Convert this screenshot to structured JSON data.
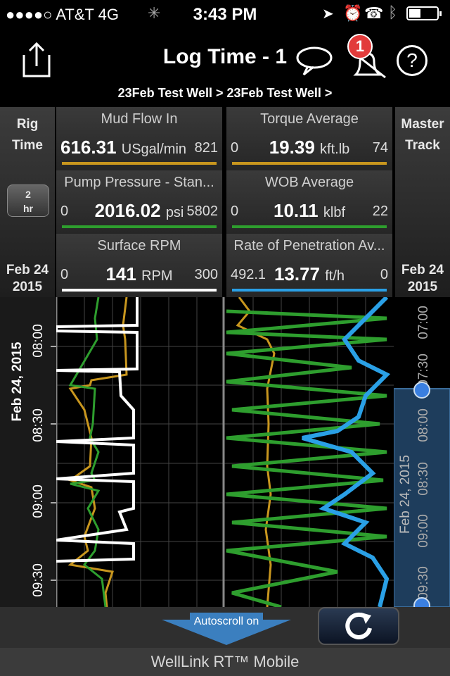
{
  "status_bar": {
    "carrier": "●●●●○ AT&T  4G",
    "time": "3:43 PM"
  },
  "header": {
    "title": "Log Time - 1",
    "notification_count": "1",
    "breadcrumb": "23Feb Test Well > 23Feb Test Well >",
    "icons": [
      "share-icon",
      "comment-icon",
      "bell-icon",
      "help-icon"
    ]
  },
  "left_panel": {
    "label_line1": "Rig",
    "label_line2": "Time",
    "range_value": "2",
    "range_unit": "hr",
    "date_line1": "Feb 24",
    "date_line2": "2015"
  },
  "right_panel": {
    "label_line1": "Master",
    "label_line2": "Track",
    "date_line1": "Feb 24",
    "date_line2": "2015"
  },
  "gauges": [
    {
      "name": "Mud Flow In",
      "value": "616.31",
      "unit": "USgal/min",
      "min": "",
      "max": "821",
      "color": "#c8961e"
    },
    {
      "name": "Torque Average",
      "value": "19.39",
      "unit": "kft.lb",
      "min": "0",
      "max": "74",
      "color": "#c8961e"
    },
    {
      "name": "Pump Pressure - Stan...",
      "value": "2016.02",
      "unit": "psi",
      "min": "0",
      "max": "5802",
      "color": "#2e9e2e"
    },
    {
      "name": "WOB Average",
      "value": "10.11",
      "unit": "klbf",
      "min": "0",
      "max": "22",
      "color": "#2e9e2e"
    },
    {
      "name": "Surface RPM",
      "value": "141",
      "unit": "RPM",
      "min": "0",
      "max": "300",
      "color": "#ffffff"
    },
    {
      "name": "Rate of Penetration Av...",
      "value": "13.77",
      "unit": "ft/h",
      "min": "492.1",
      "max": "0",
      "color": "#2aa0e6"
    }
  ],
  "time_axis": {
    "date_label": "Feb 24, 2015",
    "ticks": [
      "08:00",
      "08:30",
      "09:00",
      "09:30"
    ]
  },
  "master_track": {
    "date_label": "Feb 24, 2015",
    "ticks": [
      "07:00",
      "07:30",
      "08:00",
      "08:30",
      "09:00",
      "09:30"
    ]
  },
  "toolbar": {
    "autoscroll_label": "Autoscroll on",
    "refresh_icon": "refresh-icon"
  },
  "footer": {
    "text": "WellLink RT™ Mobile"
  },
  "colors": {
    "orange": "#c8961e",
    "green": "#2e9e2e",
    "white": "#ffffff",
    "blue": "#2aa0e6"
  }
}
